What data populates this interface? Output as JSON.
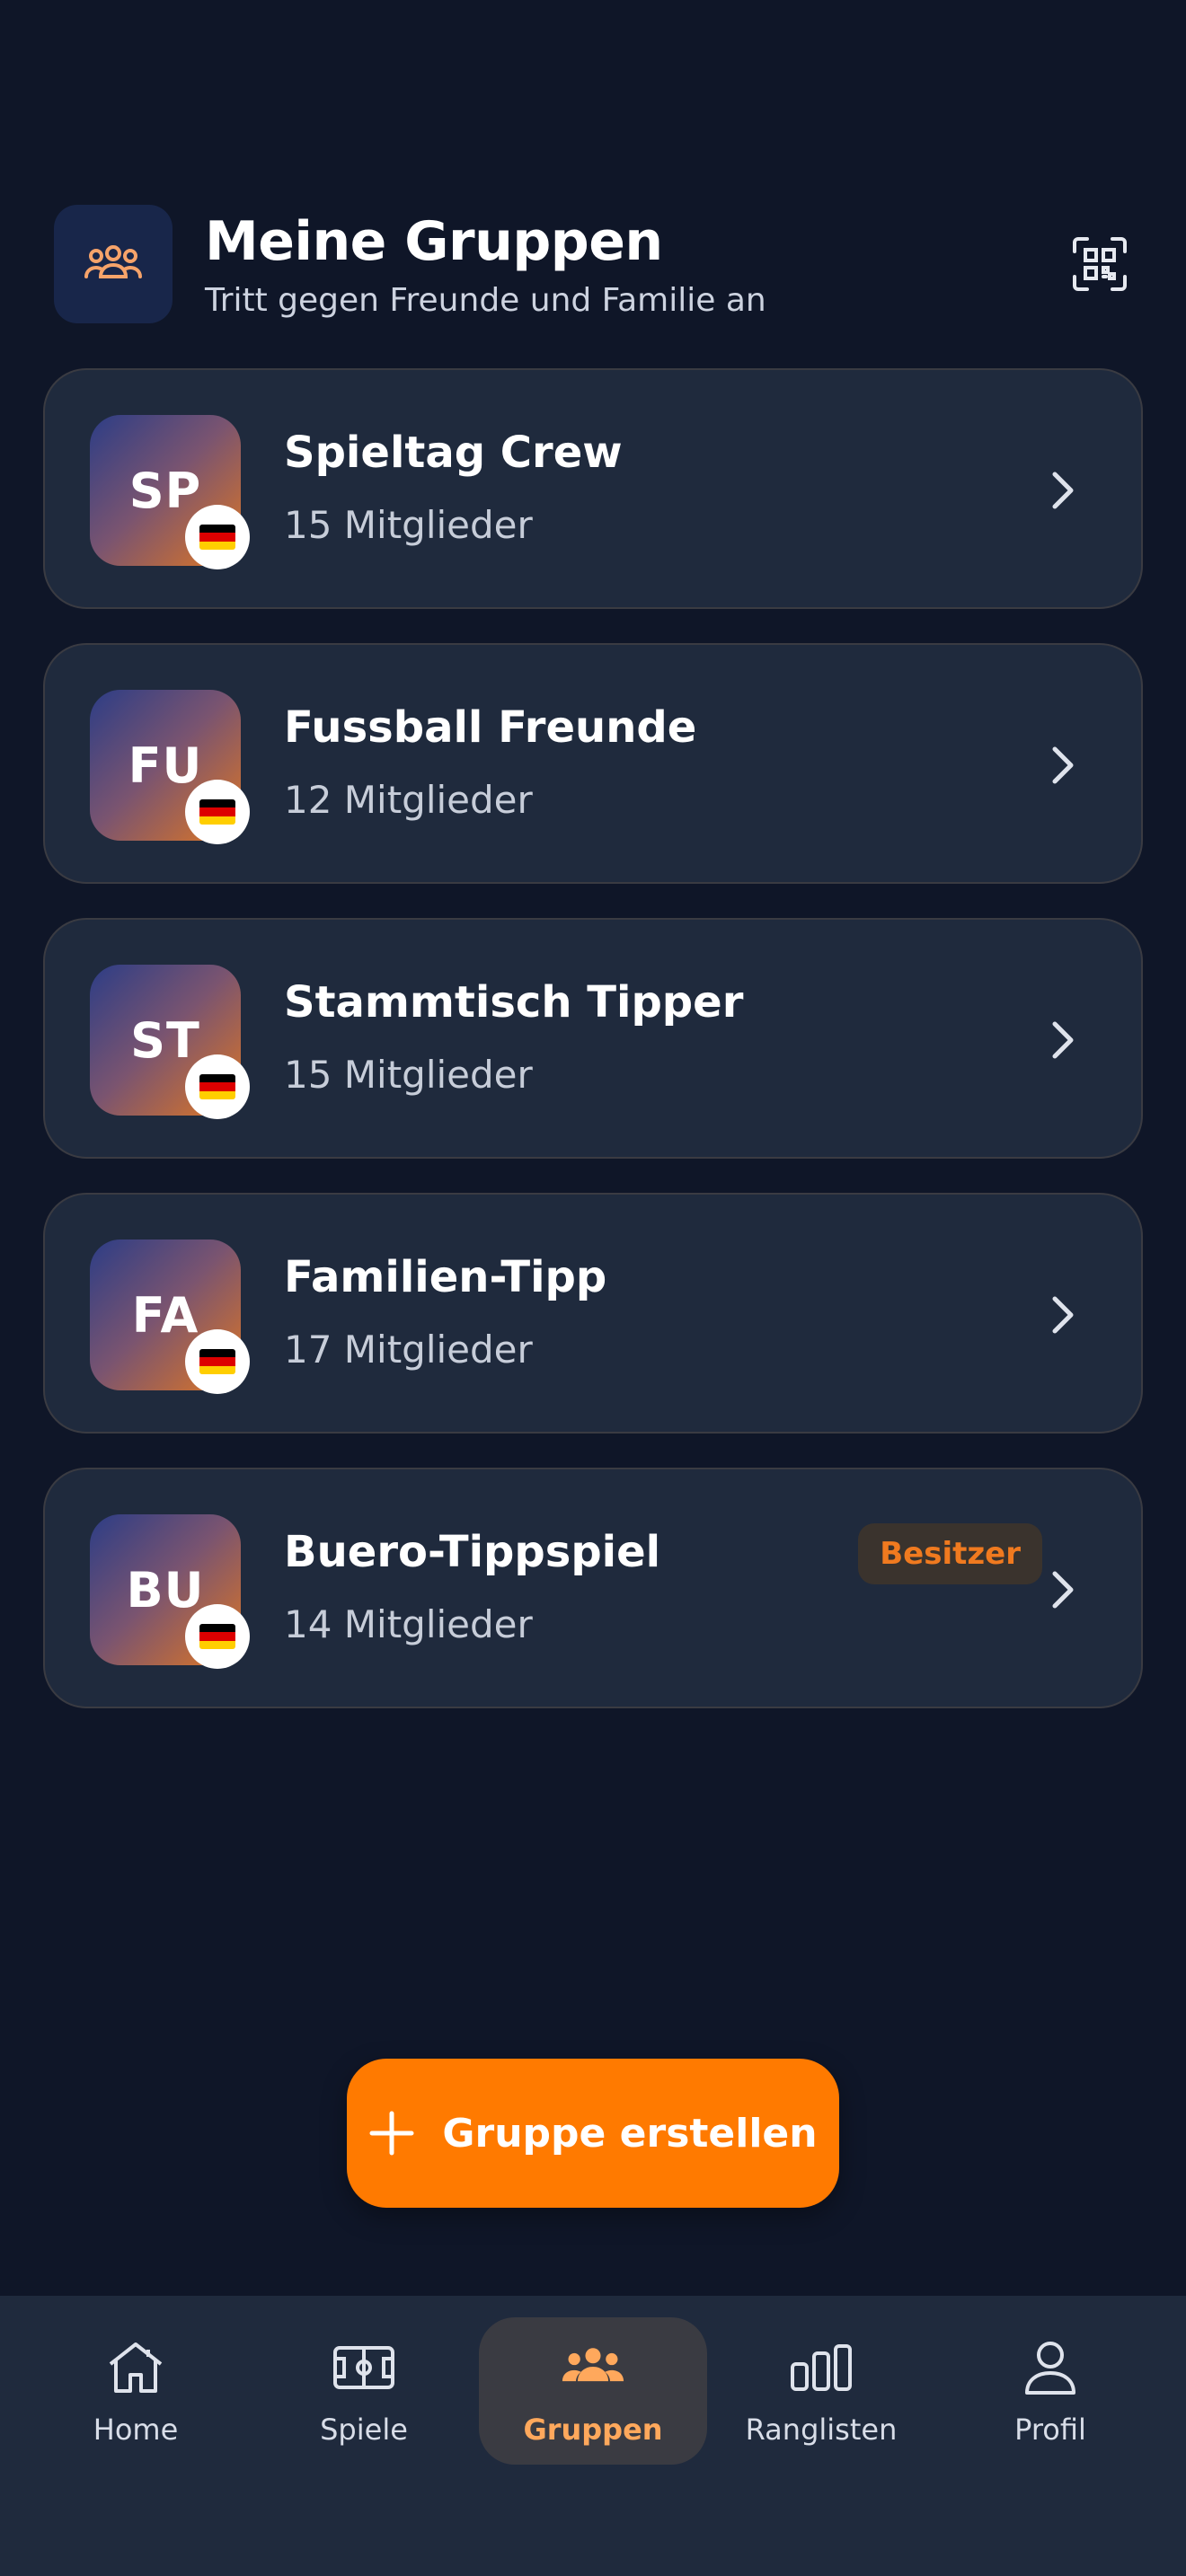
{
  "header": {
    "title": "Meine Gruppen",
    "subtitle": "Tritt gegen Freunde und Familie an",
    "badge_icon": "users-icon",
    "action_icon": "qr-scan-icon"
  },
  "groups": [
    {
      "initials": "SP",
      "name": "Spieltag Crew",
      "members": "15 Mitglieder",
      "flag": "germany",
      "badge": ""
    },
    {
      "initials": "FU",
      "name": "Fussball Freunde",
      "members": "12 Mitglieder",
      "flag": "germany",
      "badge": ""
    },
    {
      "initials": "ST",
      "name": "Stammtisch Tipper",
      "members": "15 Mitglieder",
      "flag": "germany",
      "badge": ""
    },
    {
      "initials": "FA",
      "name": "Familien-Tipp",
      "members": "17 Mitglieder",
      "flag": "germany",
      "badge": ""
    },
    {
      "initials": "BU",
      "name": "Buero-Tippspiel",
      "members": "14 Mitglieder",
      "flag": "germany",
      "badge": "Besitzer"
    }
  ],
  "create_button": {
    "label": "Gruppe erstellen",
    "icon": "plus-icon"
  },
  "nav": {
    "items": [
      {
        "label": "Home",
        "icon": "home-icon",
        "active": false
      },
      {
        "label": "Spiele",
        "icon": "pitch-icon",
        "active": false
      },
      {
        "label": "Gruppen",
        "icon": "users-icon",
        "active": true
      },
      {
        "label": "Ranglisten",
        "icon": "bar-chart-icon",
        "active": false
      },
      {
        "label": "Profil",
        "icon": "user-icon",
        "active": false
      }
    ]
  },
  "colors": {
    "background": "#0f1628",
    "card": "#1f2a3d",
    "accent": "#ff7a00",
    "active_nav_label": "#ffa85c",
    "owner_badge_text": "#f07a1f"
  }
}
